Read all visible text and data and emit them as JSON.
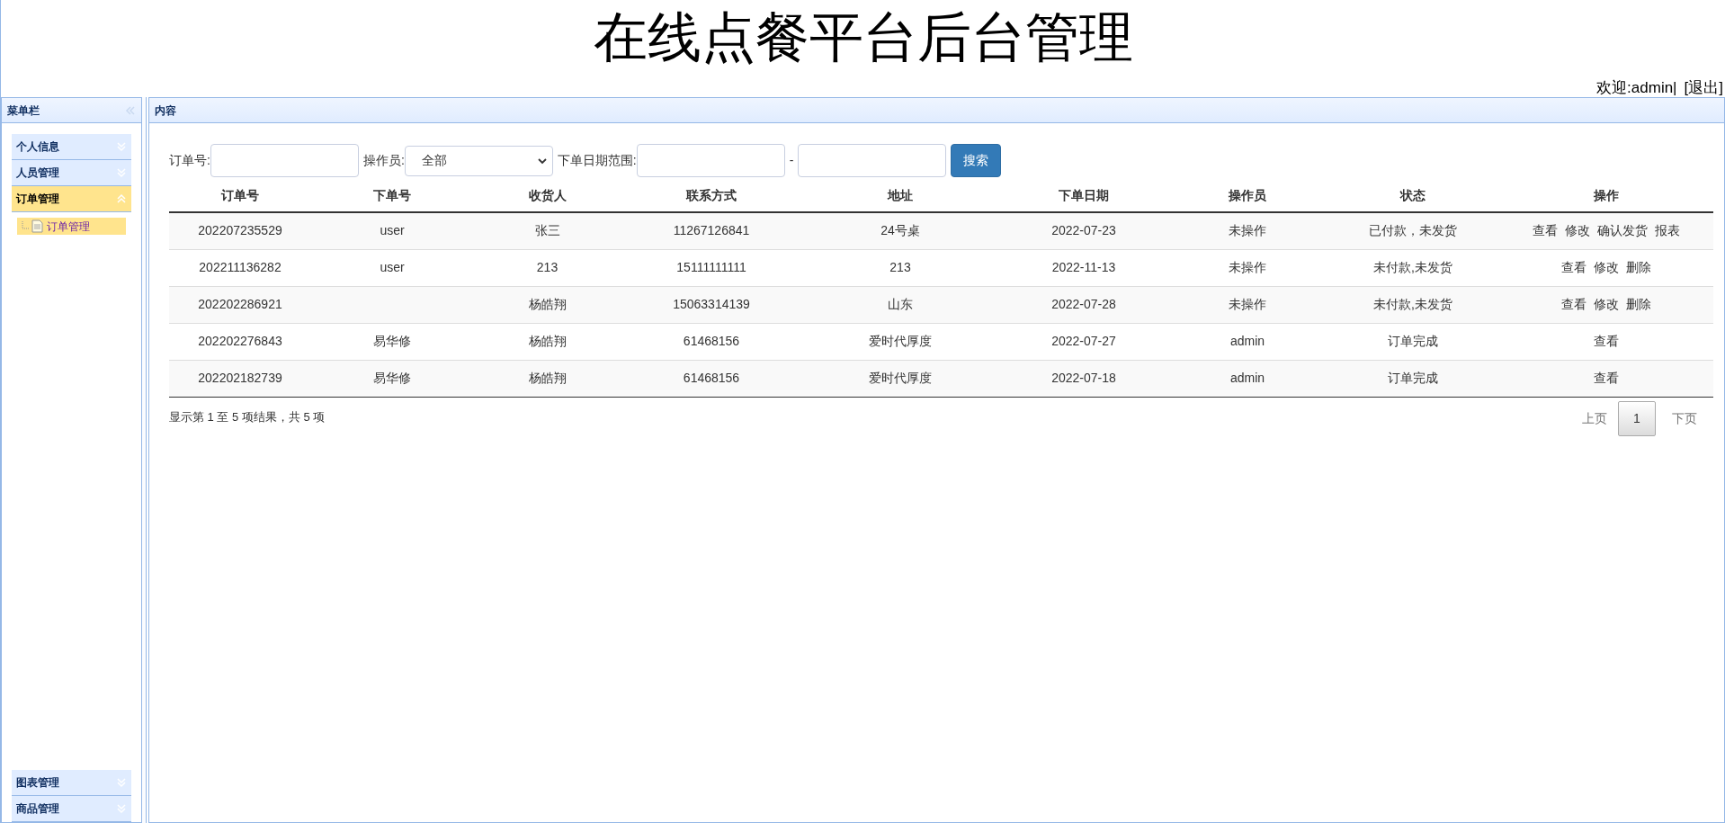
{
  "header": {
    "title": "在线点餐平台后台管理",
    "welcome": "欢迎:admin|",
    "logout": "[退出]"
  },
  "sidebar": {
    "title": "菜单栏",
    "sections": [
      {
        "label": "个人信息",
        "expanded": false
      },
      {
        "label": "人员管理",
        "expanded": false
      },
      {
        "label": "订单管理",
        "expanded": true,
        "children": [
          {
            "label": "订单管理",
            "selected": true
          }
        ]
      },
      {
        "label": "图表管理",
        "expanded": false
      },
      {
        "label": "商品管理",
        "expanded": false
      }
    ]
  },
  "content": {
    "title": "内容",
    "filters": {
      "order_label": "订单号:",
      "operator_label": "操作员:",
      "operator_value": "全部",
      "date_label": "下单日期范围:",
      "date_separator": "-",
      "search_button": "搜索"
    },
    "table": {
      "columns": [
        "订单号",
        "下单号",
        "收货人",
        "联系方式",
        "地址",
        "下单日期",
        "操作员",
        "状态",
        "操作"
      ],
      "rows": [
        {
          "cells": [
            "202207235529",
            "user",
            "张三",
            "11267126841",
            "24号桌",
            "2022-07-23",
            "未操作",
            "已付款，未发货"
          ],
          "actions": [
            "查看",
            "修改",
            "确认发货",
            "报表"
          ]
        },
        {
          "cells": [
            "202211136282",
            "user",
            "213",
            "15111111111",
            "213",
            "2022-11-13",
            "未操作",
            "未付款,未发货"
          ],
          "actions": [
            "查看",
            "修改",
            "删除"
          ]
        },
        {
          "cells": [
            "202202286921",
            "",
            "杨皓翔",
            "15063314139",
            "山东",
            "2022-07-28",
            "未操作",
            "未付款,未发货"
          ],
          "actions": [
            "查看",
            "修改",
            "删除"
          ]
        },
        {
          "cells": [
            "202202276843",
            "易华修",
            "杨皓翔",
            "61468156",
            "爱时代厚度",
            "2022-07-27",
            "admin",
            "订单完成"
          ],
          "actions": [
            "查看"
          ]
        },
        {
          "cells": [
            "202202182739",
            "易华修",
            "杨皓翔",
            "61468156",
            "爱时代厚度",
            "2022-07-18",
            "admin",
            "订单完成"
          ],
          "actions": [
            "查看"
          ]
        }
      ]
    },
    "summary": "显示第 1 至 5 项结果，共 5 项",
    "pagination": {
      "prev": "上页",
      "pages": [
        {
          "label": "1",
          "selected": true
        }
      ],
      "next": "下页"
    }
  }
}
